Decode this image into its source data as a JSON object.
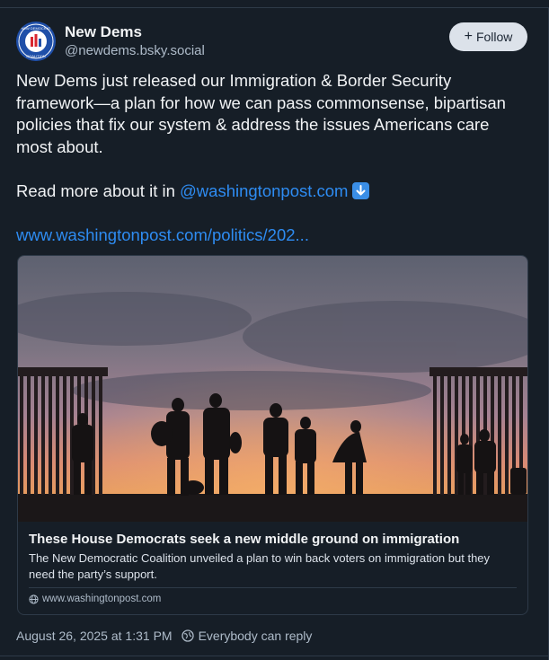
{
  "author": {
    "display_name": "New Dems",
    "handle": "@newdems.bsky.social",
    "avatar_text": "NEW DEMOCRAT COALITION"
  },
  "follow_button": {
    "label": "Follow",
    "icon": "plus-icon"
  },
  "post": {
    "paragraph1": "New Dems just released our Immigration & Border Security framework—a plan for how we can pass commonsense, bipartisan policies that fix our system & address the issues Americans care most about.",
    "read_more_prefix": "Read more about it in ",
    "mention": "@washingtonpost.com",
    "emoji": "down-arrow-emoji",
    "link": "www.washingtonpost.com/politics/202..."
  },
  "card": {
    "title": "These House Democrats seek a new middle ground on immigration",
    "description": "The New Democratic Coalition unveiled a plan to win back voters on immigration but they need the party’s support.",
    "domain": "www.washingtonpost.com",
    "image_alt": "silhouettes at border wall at dusk"
  },
  "meta": {
    "timestamp": "August 26, 2025 at 1:31 PM",
    "reply_setting": "Everybody can reply"
  },
  "colors": {
    "background": "#161e27",
    "link": "#2e8cf2",
    "muted": "#aebbc9",
    "button_bg": "#dce2ea"
  }
}
